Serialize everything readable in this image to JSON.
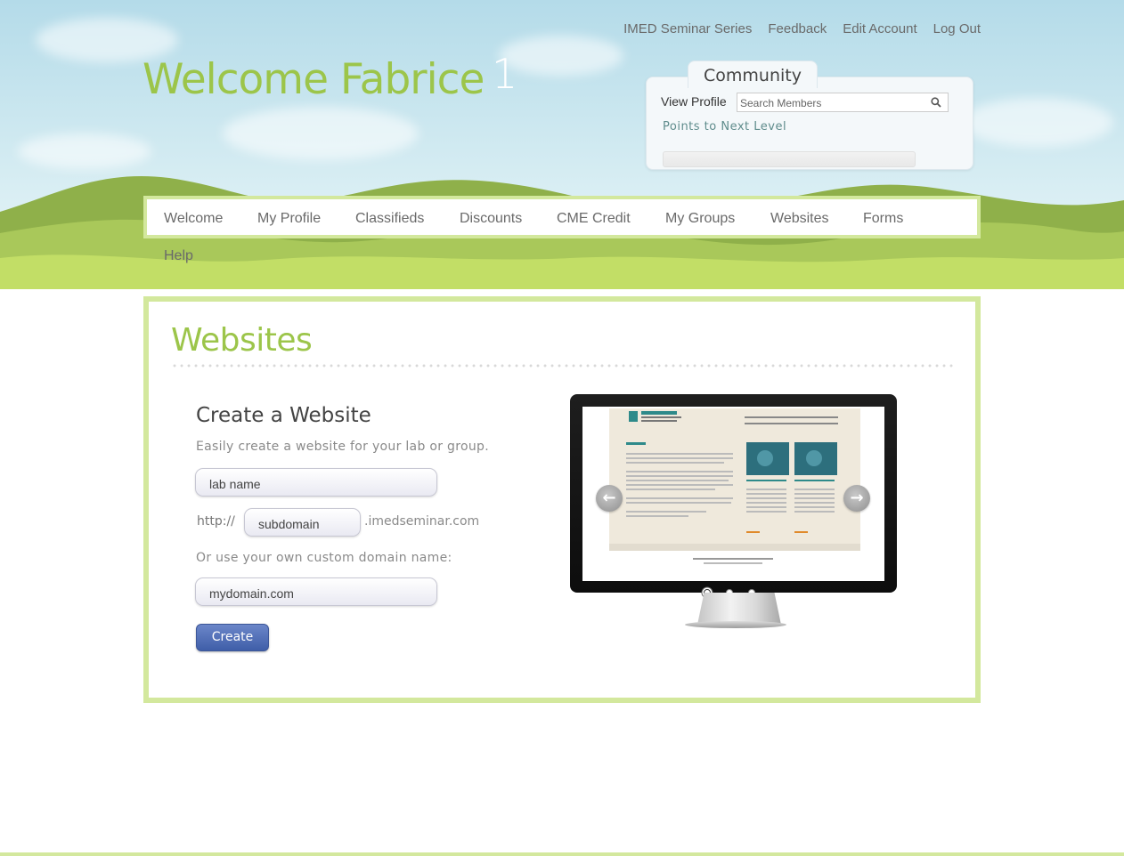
{
  "top_nav": [
    "IMED Seminar Series",
    "Feedback",
    "Edit Account",
    "Log Out"
  ],
  "welcome": {
    "greeting": "Welcome Fabrice",
    "level": "1"
  },
  "community": {
    "title": "Community",
    "view_profile": "View Profile",
    "search_placeholder": "Search Members",
    "points_label": "Points to Next Level",
    "progress": 0.0
  },
  "main_nav": [
    "Welcome",
    "My Profile",
    "Classifieds",
    "Discounts",
    "CME Credit",
    "My Groups",
    "Websites",
    "Forms",
    "Help"
  ],
  "page": {
    "title": "Websites"
  },
  "form": {
    "title": "Create a Website",
    "subtitle": "Easily create a website for your lab or group.",
    "lab_name_placeholder": "lab name",
    "http_prefix": "http://",
    "subdomain_placeholder": "subdomain",
    "domain_suffix": ".imedseminar.com",
    "custom_label": "Or use your own custom domain name:",
    "custom_placeholder": "mydomain.com",
    "create_label": "Create"
  },
  "carousel": {
    "slides": 3,
    "active": 0,
    "preview": {
      "logo": "LABWEBSITE",
      "logo_sub": "DEPARTMENT OF MOLECULAR & MEDICAL PHARMACOLOGY",
      "nav": "Home | Research | Members | Lab Pictures | Publications",
      "nav2": "In The News | Seattle Scholars Program Recent News | Links",
      "welcome": "WELCOME!",
      "caption1": "ANDREPSUM NEM SOMOLE REFUGA CORUM ETUR",
      "caption2": "ANDREPSUM NEM SOMOLE REFUGA CORUM ETUR",
      "footer": "Home   Research   Publications   People   Photos   Links"
    }
  },
  "colors": {
    "accent_green": "#9cc54a",
    "border_green": "#d3e89d",
    "button_blue": "#3f5ea8"
  }
}
